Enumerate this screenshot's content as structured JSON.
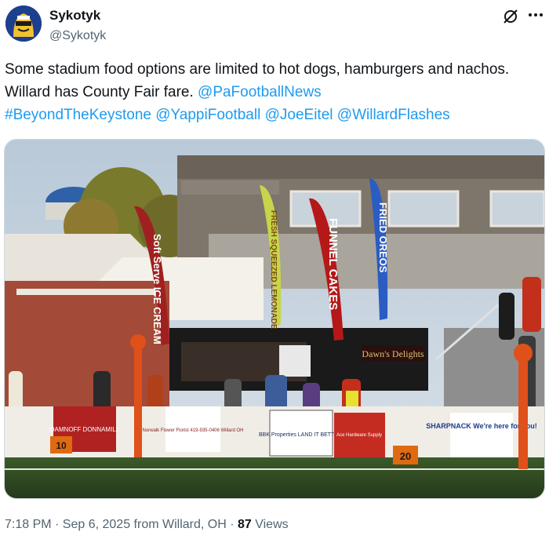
{
  "author": {
    "display_name": "Sykotyk",
    "handle": "@Sykotyk"
  },
  "tweet": {
    "text": "Some stadium food options are limited to hot dogs, hamburgers and nachos. Willard has County Fair fare. ",
    "mentions": [
      "@PaFootballNews",
      "#BeyondTheKeystone",
      "@YappiFootball",
      "@JoeEitel",
      "@WillardFlashes"
    ]
  },
  "photo": {
    "banners": {
      "ice_cream": "Soft Serve ICE CREAM",
      "lemonade": "FRESH SQUEEZED LEMONADE",
      "funnel_cakes": "FUNNEL CAKES",
      "oreos": "FRIED OREOS"
    },
    "trailer_sign": "Dawn's Delights",
    "ads": [
      "DAMNOFF DONNAMILL",
      "Norwalk Flower Florist 419-935-0406 Willard OH",
      "BBK Properties LAND IT BETTER!",
      "Ace Hardware Supply",
      "SHARPNACK We're here for you!"
    ],
    "yard_markers": [
      "10",
      "20"
    ]
  },
  "meta": {
    "time": "7:18 PM · Sep 6, 2025 from Willard, OH · ",
    "views_count": "87",
    "views_label": " Views"
  },
  "colors": {
    "link": "#1d9bf0",
    "text": "#0f1419",
    "muted": "#536471"
  },
  "icons": {
    "grok": "grok-icon",
    "more": "more-options-icon"
  }
}
